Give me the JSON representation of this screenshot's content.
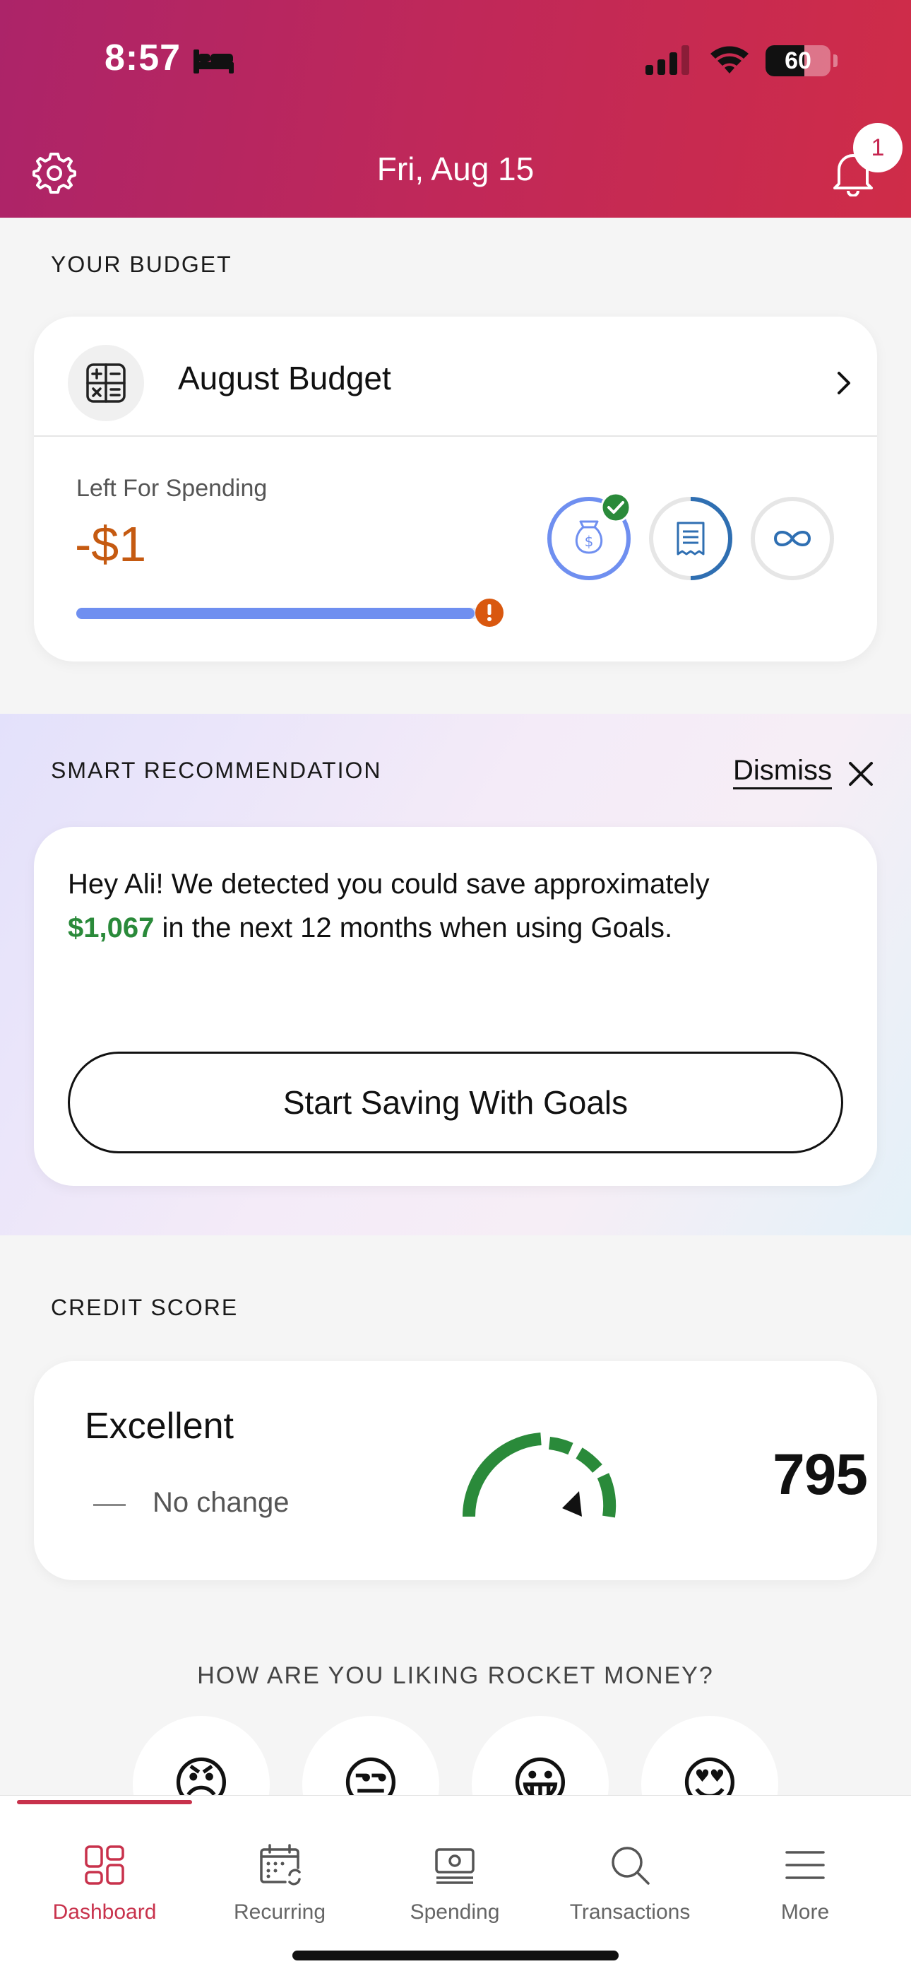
{
  "status_bar": {
    "time": "8:57",
    "battery": "60",
    "battery_level": 0.6
  },
  "header": {
    "date": "Fri, Aug 15",
    "notification_count": "1",
    "gradient": [
      "#ac2469",
      "#cf2c48"
    ]
  },
  "budget": {
    "section_title": "YOUR BUDGET",
    "name": "August Budget",
    "left_label": "Left For Spending",
    "left_value": "-$1",
    "progress": 0.99,
    "icons": [
      "money-bag-goals-icon",
      "bills-receipt-icon",
      "infinity-icon"
    ]
  },
  "recommendation": {
    "section_title": "SMART RECOMMENDATION",
    "dismiss_label": "Dismiss",
    "text_before": "Hey Ali! We detected you could save approximately",
    "amount": "$1,067",
    "text_after": "in the next 12 months when using Goals.",
    "button_label": "Start Saving With Goals"
  },
  "credit": {
    "section_title": "CREDIT SCORE",
    "rating": "Excellent",
    "change": "No change",
    "score": "795",
    "accent": "#2a8a3a"
  },
  "feedback": {
    "question": "HOW ARE YOU LIKING ROCKET MONEY?",
    "emojis": [
      "😠",
      "😒",
      "😀",
      "😍"
    ]
  },
  "tabs": [
    {
      "label": "Dashboard",
      "icon": "dashboard-icon",
      "active": true
    },
    {
      "label": "Recurring",
      "icon": "recurring-calendar-icon",
      "active": false
    },
    {
      "label": "Spending",
      "icon": "spending-cash-icon",
      "active": false
    },
    {
      "label": "Transactions",
      "icon": "search-icon",
      "active": false
    },
    {
      "label": "More",
      "icon": "menu-icon",
      "active": false
    }
  ],
  "colors": {
    "brand": "#c8324c",
    "negative": "#c55a11",
    "progress": "#6f8ff0",
    "positive": "#2a8a3a"
  }
}
